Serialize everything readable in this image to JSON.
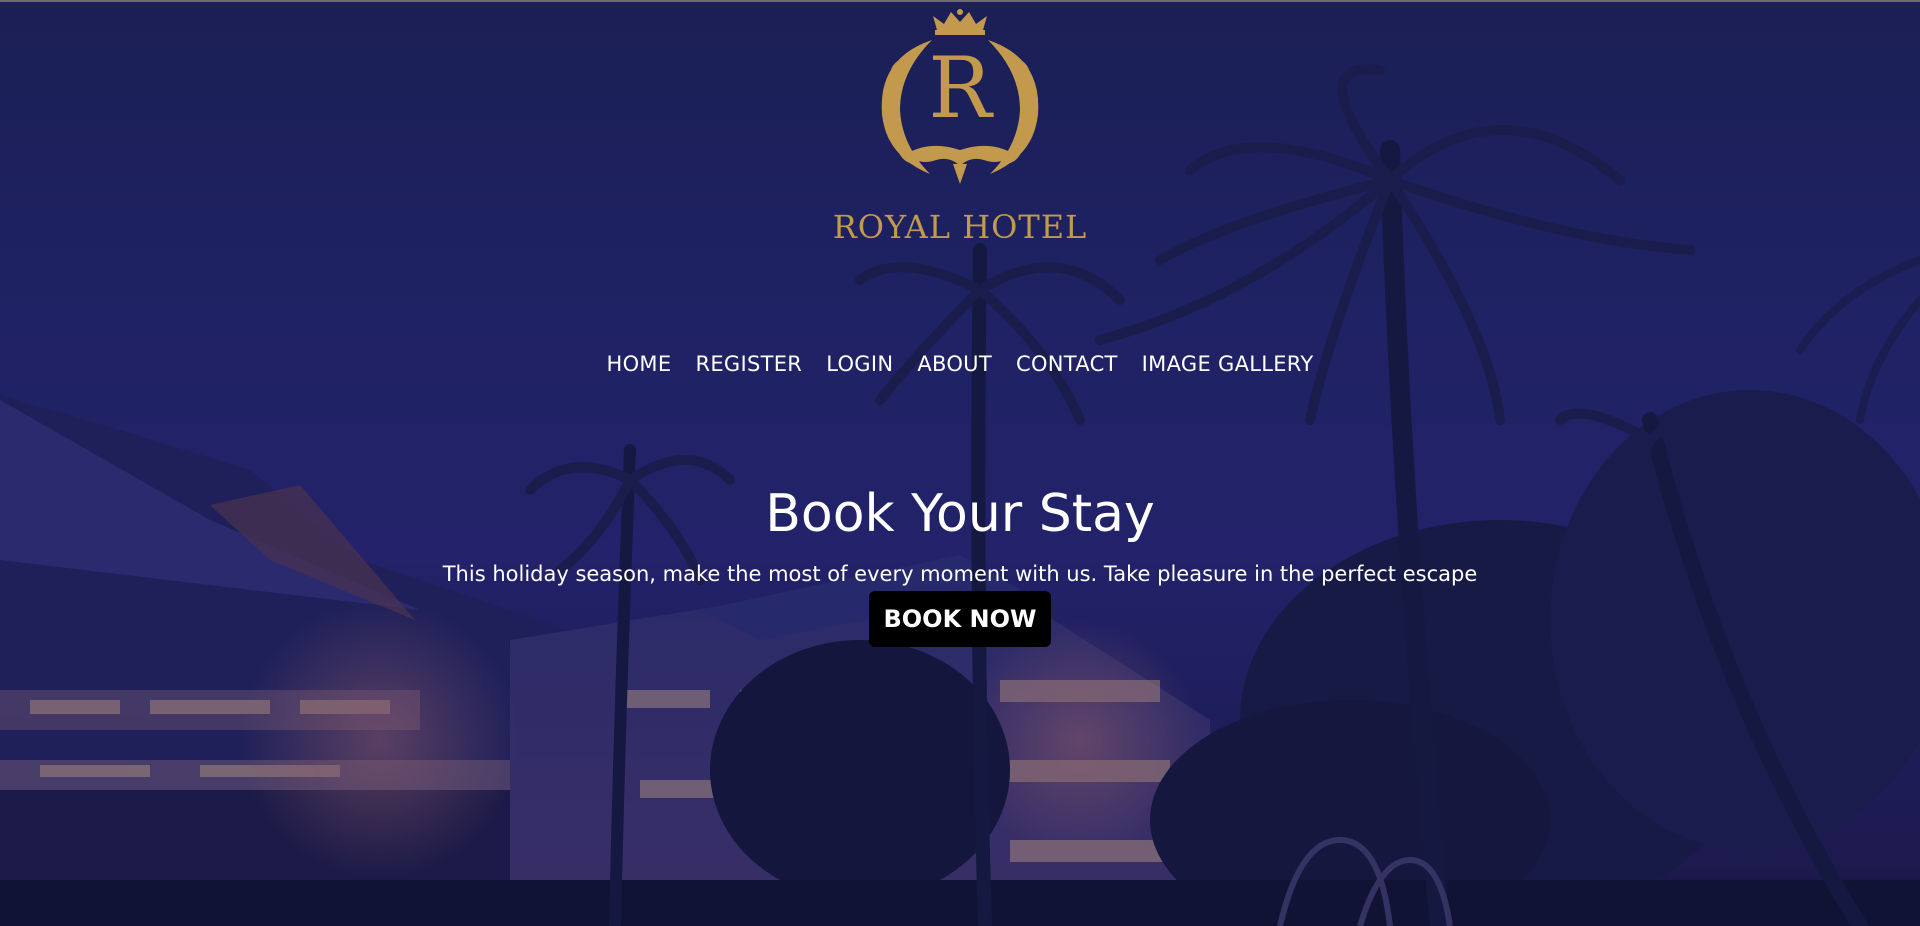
{
  "logo": {
    "monogram": "R",
    "name": "ROYAL HOTEL",
    "color": "#c39a4d"
  },
  "nav": {
    "items": [
      {
        "label": "HOME"
      },
      {
        "label": "REGISTER"
      },
      {
        "label": "LOGIN"
      },
      {
        "label": "ABOUT"
      },
      {
        "label": "CONTACT"
      },
      {
        "label": "IMAGE GALLERY"
      }
    ]
  },
  "hero": {
    "title": "Book Your Stay",
    "subtitle": "This holiday season, make the most of every moment with us. Take pleasure in the perfect escape",
    "button_label": "BOOK NOW",
    "overlay_color": "#23226a"
  },
  "icons": {
    "crown": "crown-icon",
    "laurel": "laurel-wreath-icon"
  }
}
